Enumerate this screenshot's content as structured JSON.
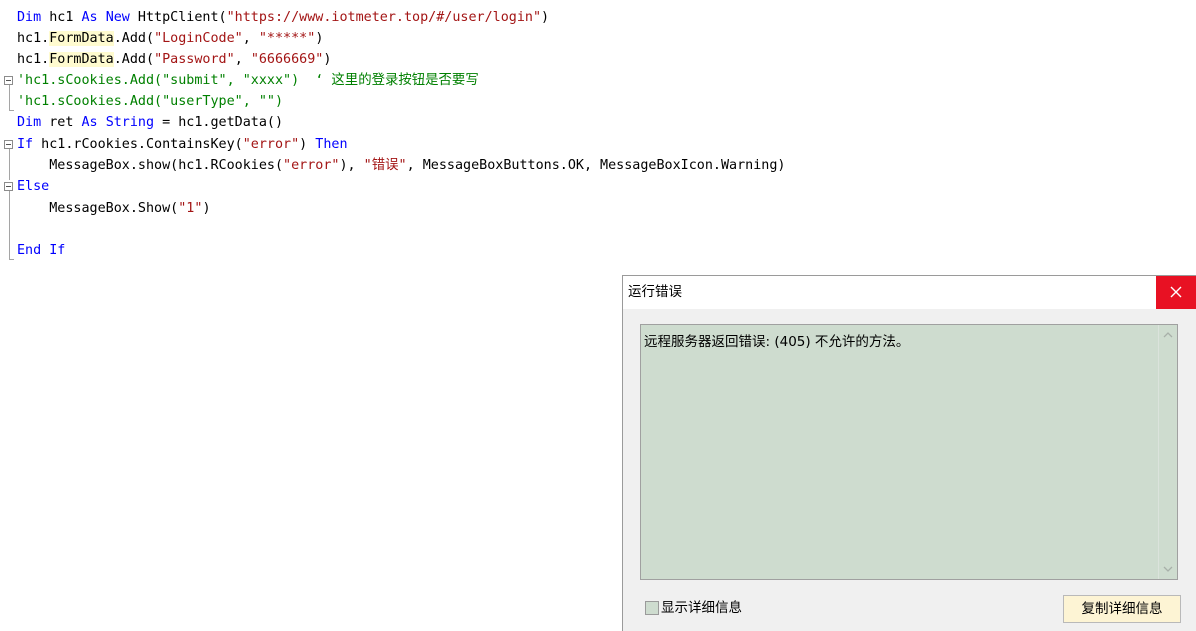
{
  "code": {
    "l1": {
      "dim": "Dim",
      "n1": " hc1 ",
      "as": "As",
      "n2": " ",
      "new": "New",
      "n3": " HttpClient(",
      "s1": "\"https://www.iotmeter.top/#/user/login\"",
      "n4": ")"
    },
    "l2": {
      "a": "hc1.",
      "fd": "FormData",
      "b": ".Add(",
      "s1": "\"LoginCode\"",
      "c": ", ",
      "s2": "\"*****\"",
      "d": ")"
    },
    "l3": {
      "a": "hc1.",
      "fd": "FormData",
      "b": ".Add(",
      "s1": "\"Password\"",
      "c": ", ",
      "s2": "\"6666669\"",
      "d": ")"
    },
    "l4": {
      "c": "'hc1.sCookies.Add(\"submit\", \"xxxx\")  ‘ 这里的登录按钮是否要写"
    },
    "l5": {
      "c": "'hc1.sCookies.Add(\"userType\", \"\")"
    },
    "l6": {
      "dim": "Dim",
      "a": " ret ",
      "as": "As",
      "b": " ",
      "str": "String",
      "c": " = hc1.getData()"
    },
    "l7": {
      "if": "If",
      "a": " hc1.rCookies.ContainsKey(",
      "s1": "\"error\"",
      "b": ") ",
      "then": "Then"
    },
    "l8": {
      "a": "    MessageBox.show(hc1.RCookies(",
      "s1": "\"error\"",
      "b": "), ",
      "s2": "\"错误\"",
      "c": ", MessageBoxButtons.OK, MessageBoxIcon.Warning)"
    },
    "l9": {
      "else": "Else"
    },
    "l10": {
      "a": "    MessageBox.Show(",
      "s1": "\"1\"",
      "b": ")"
    },
    "l12": {
      "end": "End",
      "b": " ",
      "if": "If"
    }
  },
  "dialog": {
    "title": "运行错误",
    "message": "远程服务器返回错误: (405) 不允许的方法。",
    "checkbox_label": "显示详细信息",
    "copy_button": "复制详细信息",
    "close_color": "#e81123",
    "message_bg": "#cedccf"
  }
}
